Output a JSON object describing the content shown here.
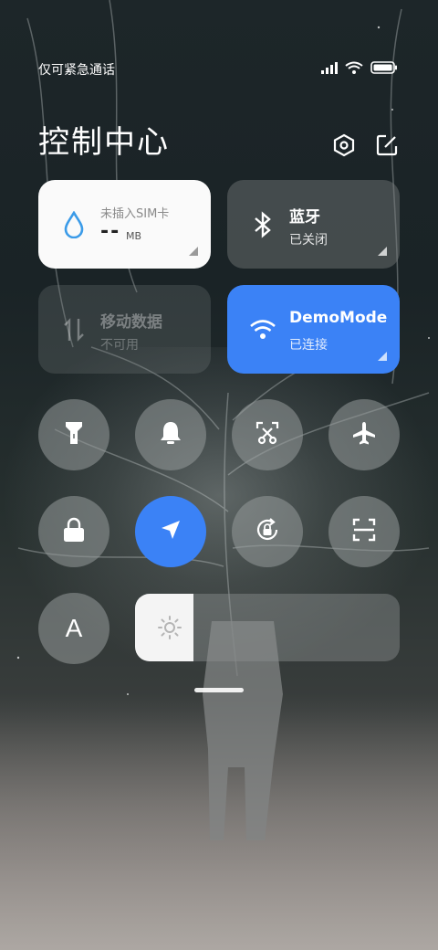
{
  "status_bar": {
    "carrier_text": "仅可紧急通话",
    "icons": [
      "signal-icon",
      "wifi-icon",
      "battery-icon"
    ]
  },
  "header": {
    "title": "控制中心",
    "icons": [
      "settings-icon",
      "edit-icon"
    ]
  },
  "tiles": {
    "data_usage": {
      "label": "未插入SIM卡",
      "value": "--",
      "unit": "MB",
      "icon": "water-drop-icon"
    },
    "bluetooth": {
      "label": "蓝牙",
      "status": "已关闭",
      "icon": "bluetooth-icon"
    },
    "mobile_data": {
      "label": "移动数据",
      "status": "不可用",
      "icon": "data-arrows-icon"
    },
    "wifi": {
      "label": "DemoMode",
      "status": "已连接",
      "icon": "wifi-icon"
    }
  },
  "toggles": [
    {
      "name": "flashlight",
      "icon": "flashlight-icon",
      "active": false
    },
    {
      "name": "sound",
      "icon": "bell-icon",
      "active": false
    },
    {
      "name": "screenshot",
      "icon": "scissors-icon",
      "active": false
    },
    {
      "name": "airplane-mode",
      "icon": "airplane-icon",
      "active": false
    },
    {
      "name": "lock-screen",
      "icon": "lock-icon",
      "active": false
    },
    {
      "name": "location",
      "icon": "location-arrow-icon",
      "active": true
    },
    {
      "name": "rotation-lock",
      "icon": "rotation-lock-icon",
      "active": false
    },
    {
      "name": "scanner",
      "icon": "scan-icon",
      "active": false
    },
    {
      "name": "font-size",
      "icon": "font-icon",
      "active": false,
      "text": "A"
    }
  ],
  "brightness": {
    "icon": "sun-icon",
    "level": 0.22
  },
  "colors": {
    "accent": "#3b82f6",
    "tile_white": "#fafafa"
  }
}
